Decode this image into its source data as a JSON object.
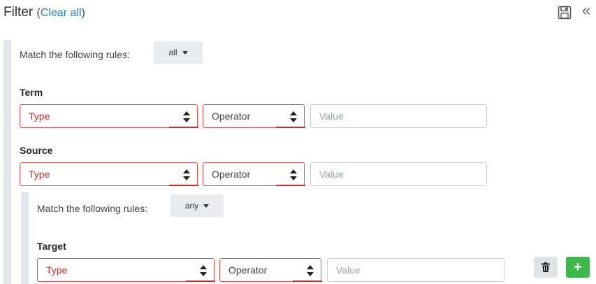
{
  "header": {
    "title": "Filter",
    "paren_open": "(",
    "clear_all": "Clear all",
    "paren_close": ")",
    "save_icon": "floppy-disk-icon",
    "collapse_icon": "double-chevron-left-icon",
    "collapse_glyph": "«"
  },
  "root_group": {
    "match_label": "Match the following rules:",
    "match_value": "all",
    "rules": [
      {
        "label": "Term",
        "type_placeholder": "Type",
        "operator_placeholder": "Operator",
        "value_placeholder": "Value"
      },
      {
        "label": "Source",
        "type_placeholder": "Type",
        "operator_placeholder": "Operator",
        "value_placeholder": "Value"
      }
    ]
  },
  "nested_group": {
    "match_label": "Match the following rules:",
    "match_value": "any",
    "rules": [
      {
        "label": "Target",
        "type_placeholder": "Type",
        "operator_placeholder": "Operator",
        "value_placeholder": "Value"
      }
    ],
    "delete_icon": "trash-icon",
    "add_icon": "plus-icon",
    "add_glyph": "+"
  },
  "colors": {
    "error_border": "#d9534f",
    "link": "#2a7ab8",
    "add_button": "#3db84a",
    "group_bar": "#e3e6ea"
  }
}
